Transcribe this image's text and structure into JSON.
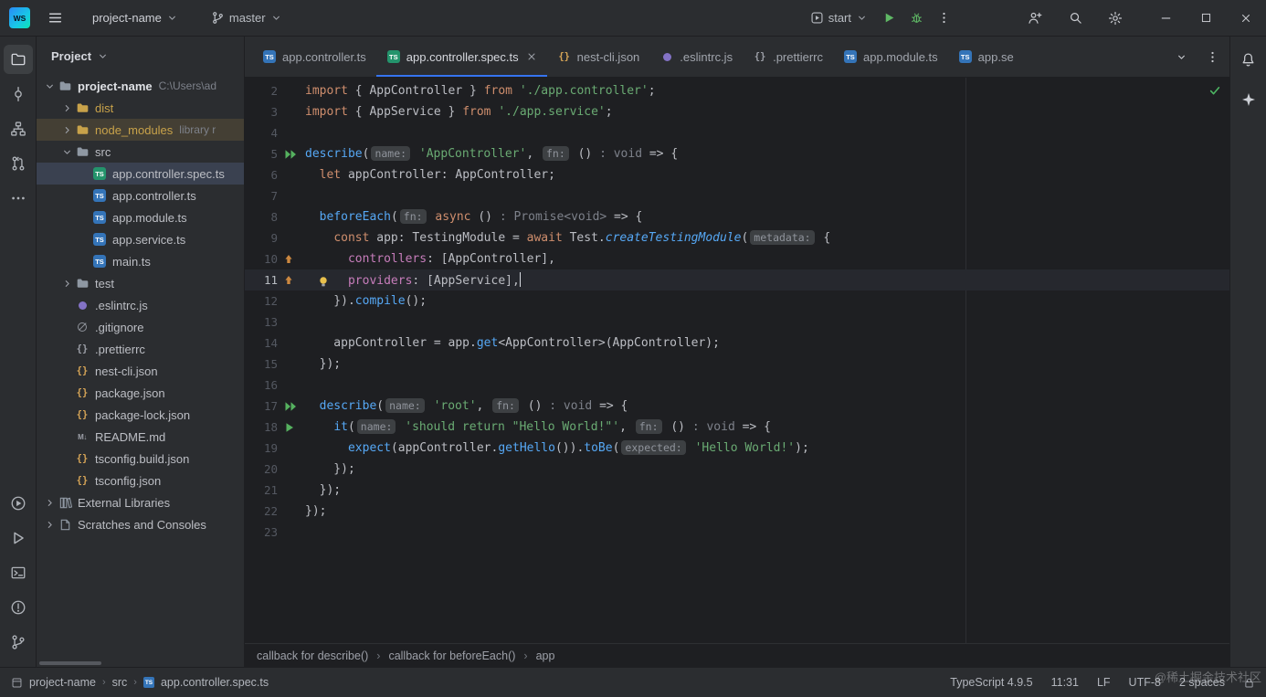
{
  "titlebar": {
    "logo_text": "WS",
    "project_label": "project-name",
    "branch_label": "master",
    "run_config_label": "start"
  },
  "activity_bar": {
    "top": [
      {
        "icon": "project-folder",
        "name": "project-tool-button",
        "active": true
      },
      {
        "icon": "commit",
        "name": "commit-tool-button"
      },
      {
        "icon": "structure",
        "name": "structure-tool-button"
      },
      {
        "icon": "pull-requests",
        "name": "pull-requests-tool-button"
      },
      {
        "icon": "more",
        "name": "more-tool-windows-button"
      }
    ],
    "bottom": [
      {
        "icon": "run-circle",
        "name": "run-tool-button"
      },
      {
        "icon": "services",
        "name": "services-tool-button"
      },
      {
        "icon": "terminal",
        "name": "terminal-tool-button"
      },
      {
        "icon": "problems",
        "name": "problems-tool-button"
      },
      {
        "icon": "vcs-branch",
        "name": "version-control-tool-button"
      }
    ]
  },
  "project_panel": {
    "header": "Project",
    "tree": [
      {
        "label": "project-name",
        "suffix": "C:\\Users\\ad",
        "level": 0,
        "icon": "folder",
        "chevron": "down",
        "bold": true
      },
      {
        "label": "dist",
        "level": 1,
        "icon": "folder",
        "chevron": "right",
        "style": "excluded"
      },
      {
        "label": "node_modules",
        "suffix": "library r",
        "level": 1,
        "icon": "folder",
        "chevron": "right",
        "style": "library"
      },
      {
        "label": "src",
        "level": 1,
        "icon": "folder",
        "chevron": "down"
      },
      {
        "label": "app.controller.spec.ts",
        "level": 2,
        "icon": "ts-test",
        "selected": true
      },
      {
        "label": "app.controller.ts",
        "level": 2,
        "icon": "ts"
      },
      {
        "label": "app.module.ts",
        "level": 2,
        "icon": "ts"
      },
      {
        "label": "app.service.ts",
        "level": 2,
        "icon": "ts"
      },
      {
        "label": "main.ts",
        "level": 2,
        "icon": "ts"
      },
      {
        "label": "test",
        "level": 1,
        "icon": "folder",
        "chevron": "right"
      },
      {
        "label": ".eslintrc.js",
        "level": 1,
        "icon": "eslint"
      },
      {
        "label": ".gitignore",
        "level": 1,
        "icon": "ignore"
      },
      {
        "label": ".prettierrc",
        "level": 1,
        "icon": "prettier"
      },
      {
        "label": "nest-cli.json",
        "level": 1,
        "icon": "json"
      },
      {
        "label": "package.json",
        "level": 1,
        "icon": "json"
      },
      {
        "label": "package-lock.json",
        "level": 1,
        "icon": "json"
      },
      {
        "label": "README.md",
        "level": 1,
        "icon": "md"
      },
      {
        "label": "tsconfig.build.json",
        "level": 1,
        "icon": "json"
      },
      {
        "label": "tsconfig.json",
        "level": 1,
        "icon": "json"
      },
      {
        "label": "External Libraries",
        "level": 0,
        "icon": "libs",
        "chevron": "right"
      },
      {
        "label": "Scratches and Consoles",
        "level": 0,
        "icon": "scratches",
        "chevron": "right"
      }
    ]
  },
  "tabs": {
    "items": [
      {
        "label": "app.controller.ts",
        "icon": "ts"
      },
      {
        "label": "app.controller.spec.ts",
        "icon": "ts-test",
        "active": true,
        "closable": true
      },
      {
        "label": "nest-cli.json",
        "icon": "json"
      },
      {
        "label": ".eslintrc.js",
        "icon": "eslint"
      },
      {
        "label": ".prettierrc",
        "icon": "prettier"
      },
      {
        "label": "app.module.ts",
        "icon": "ts"
      },
      {
        "label": "app.ser",
        "icon": "ts",
        "clipped": true
      }
    ]
  },
  "editor": {
    "lines": [
      {
        "n": 2,
        "tokens": [
          [
            "kw",
            "import"
          ],
          [
            "p",
            " { AppController } "
          ],
          [
            "kw",
            "from"
          ],
          [
            "p",
            " "
          ],
          [
            "s",
            "'./app.controller'"
          ],
          [
            "p",
            ";"
          ]
        ]
      },
      {
        "n": 3,
        "tokens": [
          [
            "kw",
            "import"
          ],
          [
            "p",
            " { AppService } "
          ],
          [
            "kw",
            "from"
          ],
          [
            "p",
            " "
          ],
          [
            "s",
            "'./app.service'"
          ],
          [
            "p",
            ";"
          ]
        ]
      },
      {
        "n": 4,
        "tokens": []
      },
      {
        "n": 5,
        "run": "all",
        "tokens": [
          [
            "fn",
            "describe"
          ],
          [
            "p",
            "("
          ],
          [
            "h",
            "name:"
          ],
          [
            "p",
            " "
          ],
          [
            "s",
            "'AppController'"
          ],
          [
            "p",
            ", "
          ],
          [
            "h",
            "fn:"
          ],
          [
            "p",
            " () "
          ],
          [
            "th",
            ": void"
          ],
          [
            "p",
            " => {"
          ]
        ]
      },
      {
        "n": 6,
        "tokens": [
          [
            "p",
            "  "
          ],
          [
            "kw",
            "let"
          ],
          [
            "p",
            " appController: AppController;"
          ]
        ]
      },
      {
        "n": 7,
        "tokens": []
      },
      {
        "n": 8,
        "tokens": [
          [
            "p",
            "  "
          ],
          [
            "fn",
            "beforeEach"
          ],
          [
            "p",
            "("
          ],
          [
            "h",
            "fn:"
          ],
          [
            "p",
            " "
          ],
          [
            "kw",
            "async"
          ],
          [
            "p",
            " () "
          ],
          [
            "th",
            ": Promise<void>"
          ],
          [
            "p",
            " => {"
          ]
        ]
      },
      {
        "n": 9,
        "tokens": [
          [
            "p",
            "    "
          ],
          [
            "kw",
            "const"
          ],
          [
            "p",
            " app: TestingModule = "
          ],
          [
            "kw",
            "await"
          ],
          [
            "p",
            " Test."
          ],
          [
            "fni",
            "createTestingModule"
          ],
          [
            "p",
            "("
          ],
          [
            "h",
            "metadata:"
          ],
          [
            "p",
            " {"
          ]
        ]
      },
      {
        "n": 10,
        "marker": true,
        "tokens": [
          [
            "p",
            "      "
          ],
          [
            "prop",
            "controllers"
          ],
          [
            "p",
            ": [AppController],"
          ]
        ]
      },
      {
        "n": 11,
        "marker": true,
        "current": true,
        "caret": true,
        "bulb": true,
        "tokens": [
          [
            "p",
            "      "
          ],
          [
            "prop",
            "providers"
          ],
          [
            "p",
            ": [AppService],"
          ]
        ]
      },
      {
        "n": 12,
        "tokens": [
          [
            "p",
            "    })."
          ],
          [
            "fn",
            "compile"
          ],
          [
            "p",
            "();"
          ]
        ]
      },
      {
        "n": 13,
        "tokens": []
      },
      {
        "n": 14,
        "tokens": [
          [
            "p",
            "    appController = app."
          ],
          [
            "fn",
            "get"
          ],
          [
            "p",
            "<AppController>(AppController);"
          ]
        ]
      },
      {
        "n": 15,
        "tokens": [
          [
            "p",
            "  });"
          ]
        ]
      },
      {
        "n": 16,
        "tokens": []
      },
      {
        "n": 17,
        "run": "all",
        "tokens": [
          [
            "p",
            "  "
          ],
          [
            "fn",
            "describe"
          ],
          [
            "p",
            "("
          ],
          [
            "h",
            "name:"
          ],
          [
            "p",
            " "
          ],
          [
            "s",
            "'root'"
          ],
          [
            "p",
            ", "
          ],
          [
            "h",
            "fn:"
          ],
          [
            "p",
            " () "
          ],
          [
            "th",
            ": void"
          ],
          [
            "p",
            " => {"
          ]
        ]
      },
      {
        "n": 18,
        "run": "one",
        "tokens": [
          [
            "p",
            "    "
          ],
          [
            "fn",
            "it"
          ],
          [
            "p",
            "("
          ],
          [
            "h",
            "name:"
          ],
          [
            "p",
            " "
          ],
          [
            "s",
            "'should return \"Hello World!\"'"
          ],
          [
            "p",
            ", "
          ],
          [
            "h",
            "fn:"
          ],
          [
            "p",
            " () "
          ],
          [
            "th",
            ": void"
          ],
          [
            "p",
            " => {"
          ]
        ]
      },
      {
        "n": 19,
        "tokens": [
          [
            "p",
            "      "
          ],
          [
            "fn",
            "expect"
          ],
          [
            "p",
            "(appController."
          ],
          [
            "fn",
            "getHello"
          ],
          [
            "p",
            "())."
          ],
          [
            "fn",
            "toBe"
          ],
          [
            "p",
            "("
          ],
          [
            "h",
            "expected:"
          ],
          [
            "p",
            " "
          ],
          [
            "s",
            "'Hello World!'"
          ],
          [
            "p",
            ");"
          ]
        ]
      },
      {
        "n": 20,
        "tokens": [
          [
            "p",
            "    });"
          ]
        ]
      },
      {
        "n": 21,
        "tokens": [
          [
            "p",
            "  });"
          ]
        ]
      },
      {
        "n": 22,
        "tokens": [
          [
            "p",
            "});"
          ]
        ]
      },
      {
        "n": 23,
        "tokens": []
      }
    ]
  },
  "breadcrumbs": [
    "callback for describe()",
    "callback for beforeEach()",
    "app"
  ],
  "statusbar": {
    "path": [
      "project-name",
      "src",
      "app.controller.spec.ts"
    ],
    "items": [
      "TypeScript 4.9.5",
      "11:31",
      "LF",
      "UTF-8",
      "2 spaces"
    ]
  },
  "watermark": "@稀土掘金技术社区",
  "colors": {
    "accent_blue": "#3574f0",
    "run_green": "#5fb865",
    "keyword_orange": "#cf8e6d",
    "string_green": "#6aab73",
    "function_blue": "#56a8f5",
    "property_purple": "#c77dbb",
    "library_yellow": "#c8a24a"
  }
}
